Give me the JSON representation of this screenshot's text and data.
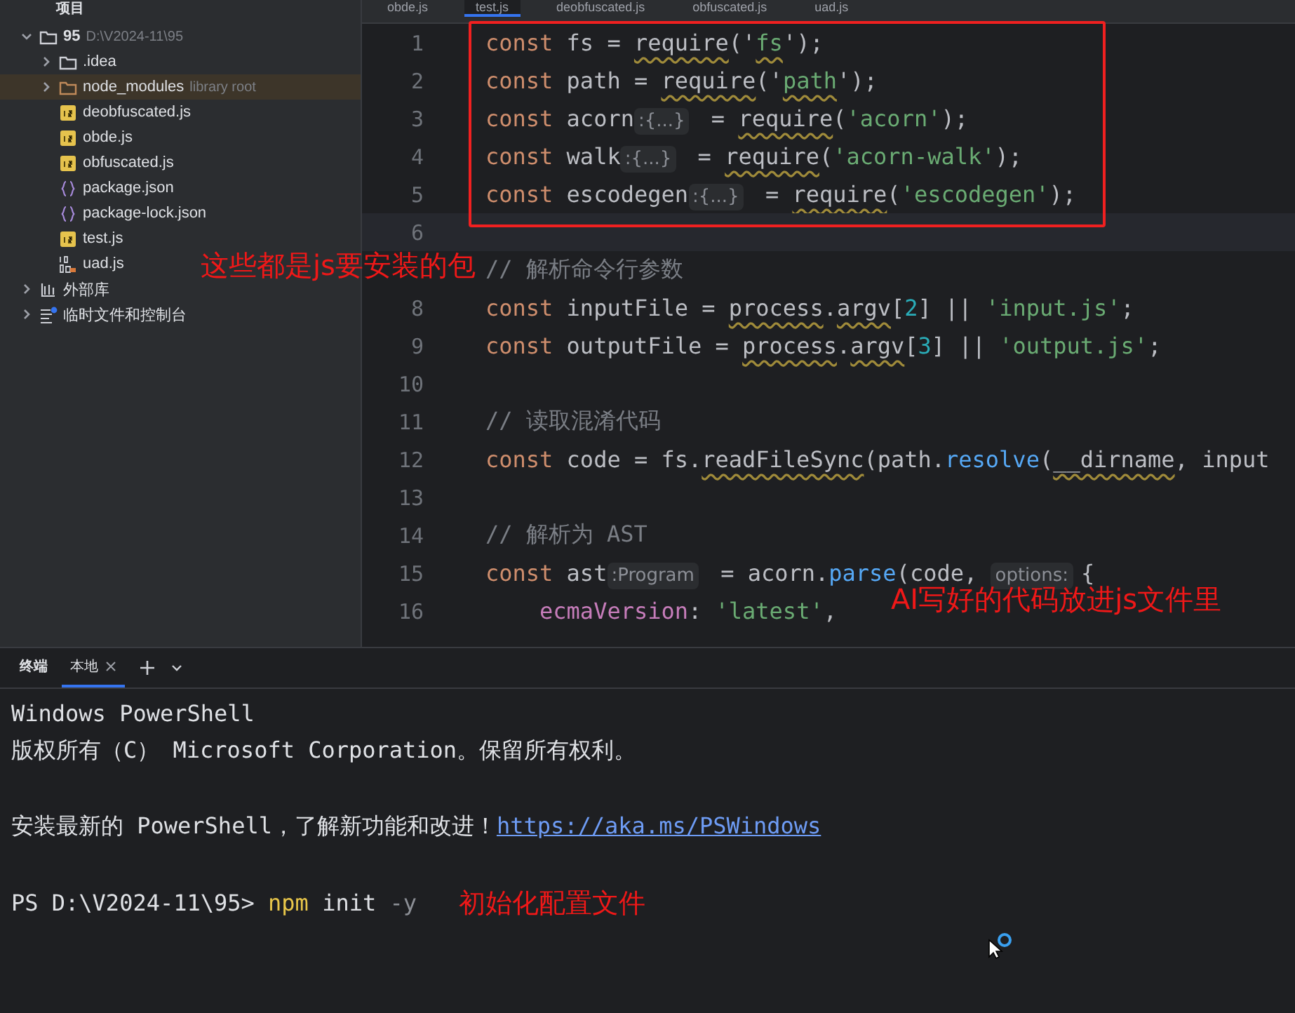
{
  "sidebar": {
    "title": "项目",
    "annotation": "这些都是js要安装的包",
    "tree": [
      {
        "label": "95",
        "path": "D:\\V2024-11\\95",
        "kind": "folder",
        "expanded": true,
        "children": [
          {
            "label": ".idea",
            "kind": "folder",
            "expanded": false
          },
          {
            "label": "node_modules",
            "hint": "library root",
            "kind": "library",
            "expanded": false
          },
          {
            "label": "deobfuscated.js",
            "kind": "js"
          },
          {
            "label": "obde.js",
            "kind": "js"
          },
          {
            "label": "obfuscated.js",
            "kind": "js"
          },
          {
            "label": "package.json",
            "kind": "json"
          },
          {
            "label": "package-lock.json",
            "kind": "json"
          },
          {
            "label": "test.js",
            "kind": "js"
          },
          {
            "label": "uad.js",
            "kind": "minjs"
          }
        ]
      },
      {
        "label": "外部库",
        "kind": "library-group",
        "expanded": false
      },
      {
        "label": "临时文件和控制台",
        "kind": "scratch",
        "expanded": false
      }
    ]
  },
  "editor": {
    "tabs": [
      {
        "label": "obde.js",
        "selected": false
      },
      {
        "label": "test.js",
        "selected": true
      },
      {
        "label": "deobfuscated.js",
        "selected": false
      },
      {
        "label": "obfuscated.js",
        "selected": false
      },
      {
        "label": "uad.js",
        "selected": false
      }
    ],
    "lines": [
      {
        "number": "1",
        "current": false,
        "segments": [
          {
            "text": "const ",
            "kind": "kw"
          },
          {
            "text": "fs = ",
            "kind": "id"
          },
          {
            "text": "require",
            "kind": "warn"
          },
          {
            "text": "('",
            "kind": "id"
          },
          {
            "text": "fs",
            "kind": "strwarn"
          },
          {
            "text": "');",
            "kind": "id"
          }
        ]
      },
      {
        "number": "2",
        "current": false,
        "segments": [
          {
            "text": "const ",
            "kind": "kw"
          },
          {
            "text": "path = ",
            "kind": "id"
          },
          {
            "text": "require",
            "kind": "warn"
          },
          {
            "text": "('",
            "kind": "id"
          },
          {
            "text": "path",
            "kind": "strwarn"
          },
          {
            "text": "');",
            "kind": "id"
          }
        ]
      },
      {
        "number": "3",
        "current": false,
        "segments": [
          {
            "text": "const ",
            "kind": "kw"
          },
          {
            "text": "acorn",
            "kind": "id"
          },
          {
            "text": ":{...}",
            "kind": "hint"
          },
          {
            "text": " = ",
            "kind": "id"
          },
          {
            "text": "require",
            "kind": "warn"
          },
          {
            "text": "(",
            "kind": "id"
          },
          {
            "text": "'acorn'",
            "kind": "str"
          },
          {
            "text": ");",
            "kind": "id"
          }
        ]
      },
      {
        "number": "4",
        "current": false,
        "segments": [
          {
            "text": "const ",
            "kind": "kw"
          },
          {
            "text": "walk",
            "kind": "id"
          },
          {
            "text": ":{...}",
            "kind": "hint"
          },
          {
            "text": " = ",
            "kind": "id"
          },
          {
            "text": "require",
            "kind": "warn"
          },
          {
            "text": "(",
            "kind": "id"
          },
          {
            "text": "'acorn-walk'",
            "kind": "str"
          },
          {
            "text": ");",
            "kind": "id"
          }
        ]
      },
      {
        "number": "5",
        "current": false,
        "segments": [
          {
            "text": "const ",
            "kind": "kw"
          },
          {
            "text": "escodegen",
            "kind": "id"
          },
          {
            "text": ":{...}",
            "kind": "hint"
          },
          {
            "text": " = ",
            "kind": "id"
          },
          {
            "text": "require",
            "kind": "warn"
          },
          {
            "text": "(",
            "kind": "id"
          },
          {
            "text": "'escodegen'",
            "kind": "str"
          },
          {
            "text": ");",
            "kind": "id"
          }
        ]
      },
      {
        "number": "6",
        "current": true
      },
      {
        "current": false,
        "segments": [
          {
            "text": "// 解析命令行参数",
            "kind": "cmt"
          }
        ]
      },
      {
        "number": "8",
        "current": false,
        "segments": [
          {
            "text": "const ",
            "kind": "kw"
          },
          {
            "text": "inputFile = ",
            "kind": "id"
          },
          {
            "text": "process",
            "kind": "warn"
          },
          {
            "text": ".",
            "kind": "id"
          },
          {
            "text": "argv",
            "kind": "warn"
          },
          {
            "text": "[",
            "kind": "id"
          },
          {
            "text": "2",
            "kind": "num"
          },
          {
            "text": "] || ",
            "kind": "id"
          },
          {
            "text": "'input.js'",
            "kind": "str"
          },
          {
            "text": ";",
            "kind": "id"
          }
        ]
      },
      {
        "number": "9",
        "current": false,
        "segments": [
          {
            "text": "const ",
            "kind": "kw"
          },
          {
            "text": "outputFile = ",
            "kind": "id"
          },
          {
            "text": "process",
            "kind": "warn"
          },
          {
            "text": ".",
            "kind": "id"
          },
          {
            "text": "argv",
            "kind": "warn"
          },
          {
            "text": "[",
            "kind": "id"
          },
          {
            "text": "3",
            "kind": "num"
          },
          {
            "text": "] || ",
            "kind": "id"
          },
          {
            "text": "'output.js'",
            "kind": "str"
          },
          {
            "text": ";",
            "kind": "id"
          }
        ]
      },
      {
        "number": "10",
        "current": false
      },
      {
        "number": "11",
        "current": false,
        "segments": [
          {
            "text": "// 读取混淆代码",
            "kind": "cmt"
          }
        ]
      },
      {
        "number": "12",
        "current": false,
        "segments": [
          {
            "text": "const ",
            "kind": "kw"
          },
          {
            "text": "code = fs.",
            "kind": "id"
          },
          {
            "text": "readFileSync",
            "kind": "warn"
          },
          {
            "text": "(path.",
            "kind": "id"
          },
          {
            "text": "resolve",
            "kind": "fn"
          },
          {
            "text": "(",
            "kind": "id"
          },
          {
            "text": "__dirname",
            "kind": "warn"
          },
          {
            "text": ", input",
            "kind": "id"
          }
        ]
      },
      {
        "number": "13",
        "current": false
      },
      {
        "number": "14",
        "current": false,
        "segments": [
          {
            "text": "// 解析为 AST",
            "kind": "cmt"
          }
        ]
      },
      {
        "number": "15",
        "current": false,
        "segments": [
          {
            "text": "const ",
            "kind": "kw"
          },
          {
            "text": "ast",
            "kind": "id"
          },
          {
            "text": ":Program",
            "kind": "hint"
          },
          {
            "text": " = acorn.",
            "kind": "id"
          },
          {
            "text": "parse",
            "kind": "fn"
          },
          {
            "text": "(code, ",
            "kind": "id"
          },
          {
            "text": "options:",
            "kind": "hint"
          },
          {
            "text": "{",
            "kind": "id"
          }
        ]
      },
      {
        "number": "16",
        "current": false,
        "segments": [
          {
            "text": "    ecmaVersion",
            "kind": "prop"
          },
          {
            "text": ": ",
            "kind": "id"
          },
          {
            "text": "'latest'",
            "kind": "str"
          },
          {
            "text": ",",
            "kind": "id"
          }
        ]
      }
    ],
    "annotation": "AI写好的代码放进js文件里"
  },
  "terminal": {
    "title": "终端",
    "tabs": [
      {
        "label": "本地",
        "selected": true
      }
    ],
    "lines": [
      {
        "segments": [
          {
            "text": "Windows PowerShell",
            "kind": "out"
          }
        ]
      },
      {
        "segments": [
          {
            "text": "版权所有（C） Microsoft Corporation。保留所有权利。",
            "kind": "out"
          }
        ]
      },
      {
        "kind": "blank"
      },
      {
        "segments": [
          {
            "text": "安装最新的 PowerShell，了解新功能和改进！",
            "kind": "out"
          },
          {
            "text": "https://aka.ms/PSWindows",
            "kind": "link"
          }
        ]
      },
      {
        "kind": "blank"
      },
      {
        "segments": [
          {
            "text": "PS D:\\V2024-11\\95> ",
            "kind": "out"
          },
          {
            "text": "npm",
            "kind": "cmd"
          },
          {
            "text": " init",
            "kind": "out"
          },
          {
            "text": " -y",
            "kind": "arg"
          }
        ]
      }
    ],
    "annotation": "初始化配置文件"
  }
}
